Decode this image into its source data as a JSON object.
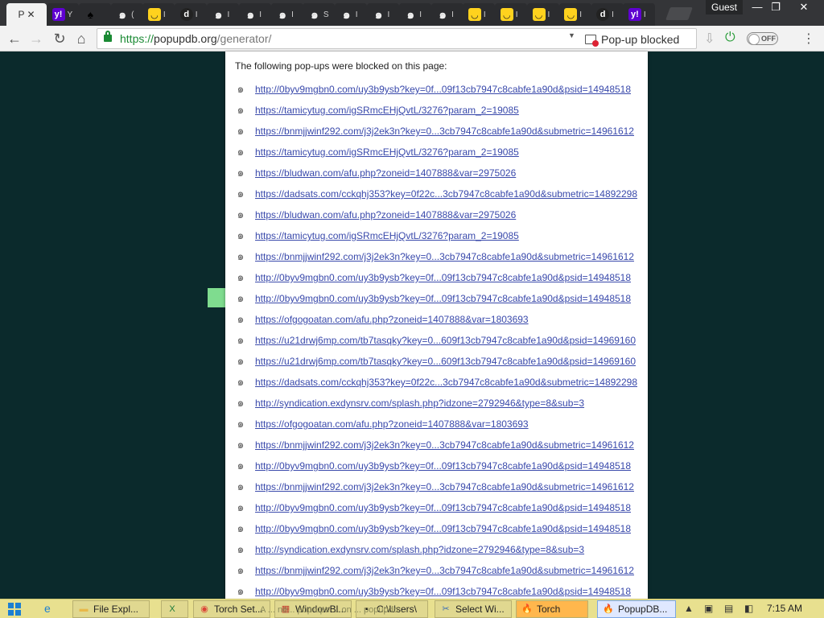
{
  "window": {
    "active_tab": {
      "label": "P",
      "close": "✕"
    },
    "tabs": [
      {
        "icon": "yahoo-icon",
        "glyph": "y!",
        "cls": "fav-yahoo",
        "label": "Y"
      },
      {
        "icon": "spade-icon",
        "glyph": "♠",
        "cls": "fav-spade",
        "label": ""
      },
      {
        "icon": "spiral-icon",
        "glyph": "๑",
        "cls": "fav-spiral",
        "label": "("
      },
      {
        "icon": "smiley-icon",
        "glyph": "◡",
        "cls": "fav-yellow",
        "label": "I"
      },
      {
        "icon": "dark-logo-icon",
        "glyph": "d",
        "cls": "fav-dark",
        "label": "I"
      },
      {
        "icon": "spiral-icon",
        "glyph": "๑",
        "cls": "fav-spiral",
        "label": "I"
      },
      {
        "icon": "spiral-icon",
        "glyph": "๑",
        "cls": "fav-spiral",
        "label": "I"
      },
      {
        "icon": "spiral-icon",
        "glyph": "๑",
        "cls": "fav-spiral",
        "label": "I"
      },
      {
        "icon": "spiral-icon",
        "glyph": "๑",
        "cls": "fav-spiral",
        "label": "S"
      },
      {
        "icon": "spiral-icon",
        "glyph": "๑",
        "cls": "fav-spiral",
        "label": "I"
      },
      {
        "icon": "spiral-icon",
        "glyph": "๑",
        "cls": "fav-spiral",
        "label": "I"
      },
      {
        "icon": "spiral-icon",
        "glyph": "๑",
        "cls": "fav-spiral",
        "label": "I"
      },
      {
        "icon": "spiral-icon",
        "glyph": "๑",
        "cls": "fav-spiral",
        "label": "I"
      },
      {
        "icon": "smiley-icon",
        "glyph": "◡",
        "cls": "fav-yellow",
        "label": "I"
      },
      {
        "icon": "smiley-icon",
        "glyph": "◡",
        "cls": "fav-yellow",
        "label": "I"
      },
      {
        "icon": "smiley-icon",
        "glyph": "◡",
        "cls": "fav-yellow",
        "label": "I"
      },
      {
        "icon": "smiley-icon",
        "glyph": "◡",
        "cls": "fav-yellow",
        "label": "I"
      },
      {
        "icon": "dark-logo-icon",
        "glyph": "d",
        "cls": "fav-dark",
        "label": "I"
      },
      {
        "icon": "yahoo-icon",
        "glyph": "y!",
        "cls": "fav-yahoo",
        "label": "I"
      }
    ],
    "guest_label": "Guest",
    "controls": {
      "minimize": "—",
      "restore": "❐",
      "close": "✕"
    }
  },
  "toolbar": {
    "back": "←",
    "forward": "→",
    "reload": "↻",
    "home": "⌂",
    "url_scheme": "https://",
    "url_host": "popupdb.org",
    "url_path": "/generator/",
    "dropdown_glyph": "▼",
    "popup_blocked_label": "Pop-up blocked",
    "toggle_label": "OFF",
    "menu_glyph": "⋮"
  },
  "blocked_popups": {
    "heading": "The following pop-ups were blocked on this page:",
    "items": [
      "http://0byv9mgbn0.com/uy3b9ysb?key=0f...09f13cb7947c8cabfe1a90d&psid=14948518",
      "https://tamicytug.com/igSRmcEHjQvtL/3276?param_2=19085",
      "https://bnmjjwinf292.com/j3j2ek3n?key=0...3cb7947c8cabfe1a90d&submetric=14961612",
      "https://tamicytug.com/igSRmcEHjQvtL/3276?param_2=19085",
      "https://bludwan.com/afu.php?zoneid=1407888&var=2975026",
      "https://dadsats.com/cckqhj353?key=0f22c...3cb7947c8cabfe1a90d&submetric=14892298",
      "https://bludwan.com/afu.php?zoneid=1407888&var=2975026",
      "https://tamicytug.com/igSRmcEHjQvtL/3276?param_2=19085",
      "https://bnmjjwinf292.com/j3j2ek3n?key=0...3cb7947c8cabfe1a90d&submetric=14961612",
      "http://0byv9mgbn0.com/uy3b9ysb?key=0f...09f13cb7947c8cabfe1a90d&psid=14948518",
      "http://0byv9mgbn0.com/uy3b9ysb?key=0f...09f13cb7947c8cabfe1a90d&psid=14948518",
      "https://ofgogoatan.com/afu.php?zoneid=1407888&var=1803693",
      "https://u21drwj6mp.com/tb7tasqky?key=0...609f13cb7947c8cabfe1a90d&psid=14969160",
      "https://u21drwj6mp.com/tb7tasqky?key=0...609f13cb7947c8cabfe1a90d&psid=14969160",
      "https://dadsats.com/cckqhj353?key=0f22c...3cb7947c8cabfe1a90d&submetric=14892298",
      "http://syndication.exdynsrv.com/splash.php?idzone=2792946&type=8&sub=3",
      "https://ofgogoatan.com/afu.php?zoneid=1407888&var=1803693",
      "https://bnmjjwinf292.com/j3j2ek3n?key=0...3cb7947c8cabfe1a90d&submetric=14961612",
      "http://0byv9mgbn0.com/uy3b9ysb?key=0f...09f13cb7947c8cabfe1a90d&psid=14948518",
      "https://bnmjjwinf292.com/j3j2ek3n?key=0...3cb7947c8cabfe1a90d&submetric=14961612",
      "http://0byv9mgbn0.com/uy3b9ysb?key=0f...09f13cb7947c8cabfe1a90d&psid=14948518",
      "http://0byv9mgbn0.com/uy3b9ysb?key=0f...09f13cb7947c8cabfe1a90d&psid=14948518",
      "http://syndication.exdynsrv.com/splash.php?idzone=2792946&type=8&sub=3",
      "https://bnmjjwinf292.com/j3j2ek3n?key=0...3cb7947c8cabfe1a90d&submetric=14961612",
      "http://0byv9mgbn0.com/uy3b9ysb?key=0f...09f13cb7947c8cabfe1a90d&psid=14948518"
    ]
  },
  "taskbar": {
    "items": [
      {
        "label": "File Expl...",
        "icon": "folder-icon",
        "glyph": "▬",
        "color": "#e8b84a"
      },
      {
        "label": "",
        "icon": "excel-icon",
        "glyph": "X",
        "color": "#1d7b3a"
      },
      {
        "label": "Torch Set...",
        "icon": "chrome-icon",
        "glyph": "◉",
        "color": "#db4437"
      },
      {
        "label": "WindowBl...",
        "icon": "windowblinds-icon",
        "glyph": "▦",
        "color": "#c0392b"
      },
      {
        "label": "C:\\Users\\",
        "icon": "cmd-icon",
        "glyph": "▪",
        "color": "#111"
      },
      {
        "label": "Select Wi...",
        "icon": "snipping-icon",
        "glyph": "✂",
        "color": "#3b6fb6"
      },
      {
        "label": "Torch",
        "icon": "torch-icon",
        "glyph": "🔥",
        "color": "#ff7a00"
      },
      {
        "label": "PopupDB...",
        "icon": "torch-icon",
        "glyph": "🔥",
        "color": "#ff7a00"
      }
    ],
    "ghost_text": "A ... ne... pop-ups ... on ... popupdb ...",
    "clock": "7:15 AM"
  }
}
